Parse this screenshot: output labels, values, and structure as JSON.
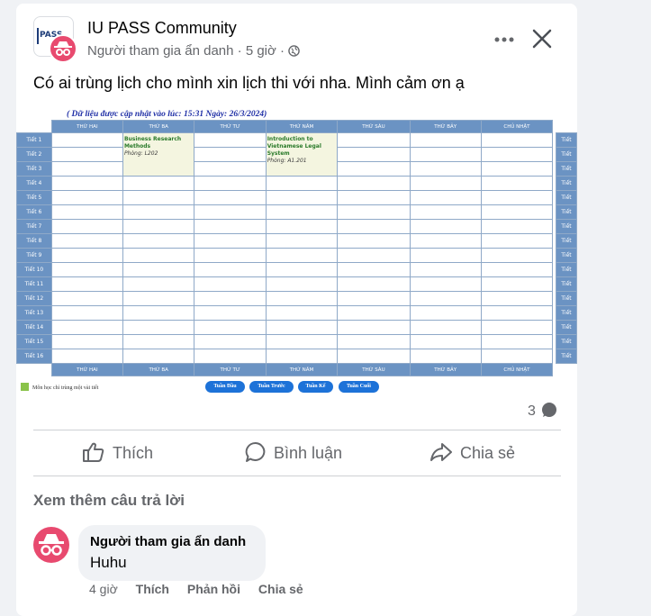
{
  "post": {
    "group_name": "IU PASS Community",
    "group_logo_text": "PASS",
    "author": "Người tham gia ẩn danh",
    "time": "5 giờ",
    "separator": "·",
    "text": "Có ai trùng lịch cho mình xin lịch thi với nha. Mình cảm ơn ạ",
    "comment_count": "3"
  },
  "schedule": {
    "banner": "( Dữ liệu được cập nhật vào lúc: 15:31 Ngày: 26/3/2024)",
    "days": [
      "THỨ HAI",
      "THỨ BA",
      "THỨ TƯ",
      "THỨ NĂM",
      "THỨ SÁU",
      "THỨ BẢY",
      "CHỦ NHẬT"
    ],
    "periods": [
      "Tiết 1",
      "Tiết 2",
      "Tiết 3",
      "Tiết 4",
      "Tiết 5",
      "Tiết 6",
      "Tiết 7",
      "Tiết 8",
      "Tiết 9",
      "Tiết 10",
      "Tiết 11",
      "Tiết 12",
      "Tiết 13",
      "Tiết 14",
      "Tiết 15",
      "Tiết 16"
    ],
    "right_labels": [
      "Tiết",
      "Tiết",
      "Tiết",
      "Tiết",
      "Tiết",
      "Tiết",
      "Tiết",
      "Tiết",
      "Tiết",
      "Tiết",
      "Tiết",
      "Tiết",
      "Tiết",
      "Tiết",
      "Tiết",
      "Tiết"
    ],
    "courses": [
      {
        "day_index": 1,
        "name": "Business Research Methods",
        "room": "Phòng: L202",
        "start": 1,
        "span": 3
      },
      {
        "day_index": 3,
        "name": "Introduction to Vietnamese Legal System",
        "room": "Phòng: A1.201",
        "start": 1,
        "span": 3
      }
    ],
    "legend": "Môn học chỉ trùng một vài tiết",
    "nav": [
      "Tuần Đầu",
      "Tuần Trước",
      "Tuần Kế",
      "Tuần Cuối"
    ]
  },
  "actions": {
    "like": "Thích",
    "comment": "Bình luận",
    "share": "Chia sẻ"
  },
  "comments": {
    "see_more": "Xem thêm câu trả lời",
    "items": [
      {
        "author": "Người tham gia ẩn danh",
        "text": "Huhu",
        "time": "4 giờ",
        "like": "Thích",
        "reply": "Phản hồi",
        "share": "Chia sẻ"
      }
    ]
  },
  "colors": {
    "header_blue": "#6b93c3",
    "course_bg": "#f4f5e0",
    "course_text": "#2a7a2a",
    "nav_blue": "#1d72d8",
    "legend_green": "#8ac34a",
    "anon_avatar": "#e84a6f"
  },
  "icons": [
    "anonymous-icon",
    "globe-icon",
    "more-icon",
    "close-icon",
    "comment-bubble-icon",
    "like-icon",
    "comment-icon",
    "share-icon"
  ]
}
